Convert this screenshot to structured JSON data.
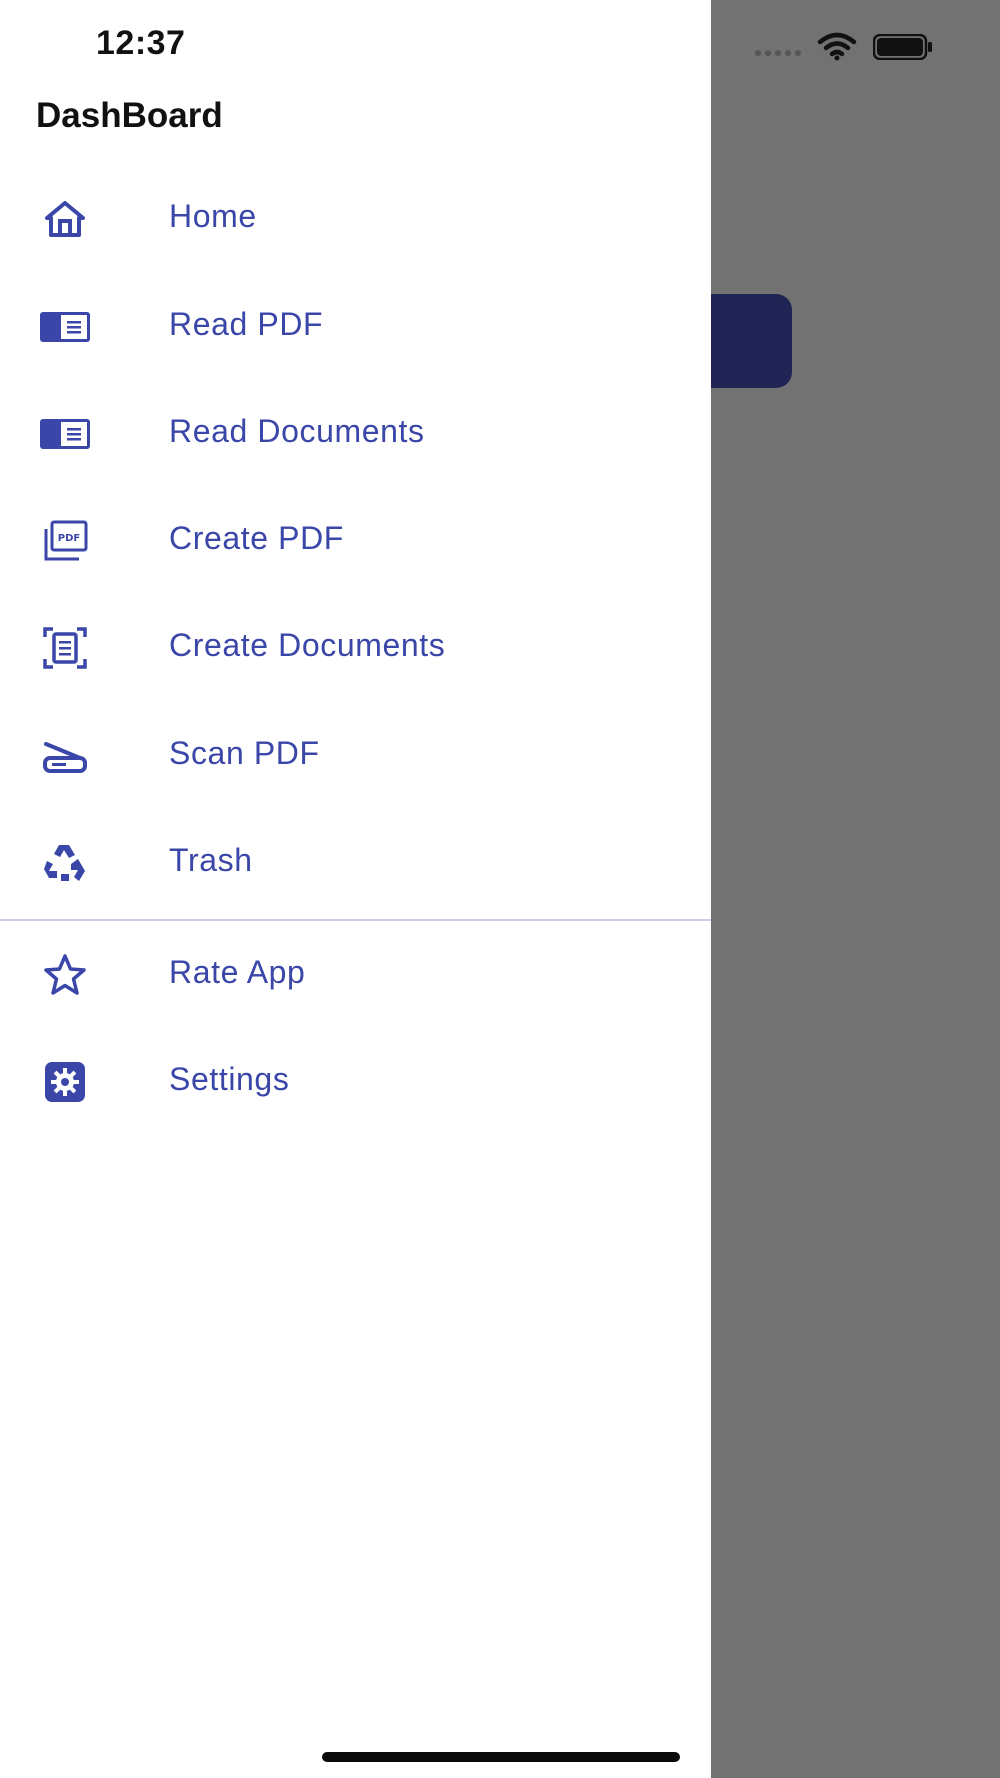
{
  "status_bar": {
    "time": "12:37"
  },
  "drawer": {
    "title": "DashBoard",
    "items": [
      {
        "label": "Home",
        "icon": "home-icon"
      },
      {
        "label": "Read PDF",
        "icon": "book-icon"
      },
      {
        "label": "Read Documents",
        "icon": "book-icon"
      },
      {
        "label": "Create PDF",
        "icon": "pdf-icon"
      },
      {
        "label": "Create Documents",
        "icon": "document-scan-icon"
      },
      {
        "label": "Scan PDF",
        "icon": "scanner-icon"
      },
      {
        "label": "Trash",
        "icon": "recycle-icon"
      }
    ],
    "secondary_items": [
      {
        "label": "Rate App",
        "icon": "star-icon"
      },
      {
        "label": "Settings",
        "icon": "gear-icon"
      }
    ]
  },
  "colors": {
    "accent": "#3a46a8",
    "overlay": "#727272",
    "background_card": "#1f2454"
  }
}
